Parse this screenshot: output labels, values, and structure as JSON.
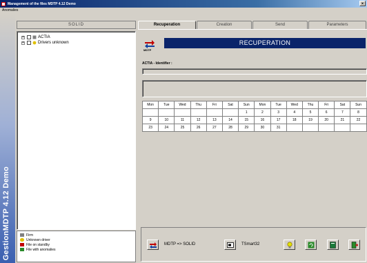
{
  "window": {
    "title": "Management of the files MDTP 4.12 Demo",
    "close_glyph": "×"
  },
  "menu": {
    "items": [
      "Anomalies"
    ]
  },
  "side_banner": {
    "text": "GestionMDTP 4.12 Demo"
  },
  "left_panel": {
    "header": "SOLID",
    "tree": [
      {
        "label": "ACTIA",
        "expand": "+"
      },
      {
        "label": "Drivers unknown",
        "expand": "+"
      }
    ],
    "legend": [
      {
        "label": "Firm",
        "color": "#808080"
      },
      {
        "label": "Unknown driver",
        "color": "#e0c000"
      },
      {
        "label": "File on standby",
        "color": "#c00000"
      },
      {
        "label": "File with anomalies",
        "color": "#2a8a2a"
      }
    ]
  },
  "tabs": [
    {
      "label": "Recuperation",
      "active": true
    },
    {
      "label": "Creation",
      "active": false
    },
    {
      "label": "Send",
      "active": false
    },
    {
      "label": "Parameters",
      "active": false
    }
  ],
  "recuperation": {
    "logo_label": "MDTP",
    "banner": "RECUPERATION",
    "identifier_label": "ACTIA - Identifier :",
    "calendar": {
      "headers": [
        "Mon",
        "Tue",
        "Wed",
        "Thu",
        "Fri",
        "Sat",
        "Sun",
        "Mon",
        "Tue",
        "Wed",
        "Thu",
        "Fri",
        "Sat",
        "Sun"
      ],
      "rows": [
        [
          "",
          "",
          "",
          "",
          "",
          "",
          "1",
          "2",
          "3",
          "4",
          "5",
          "6",
          "7",
          "8"
        ],
        [
          "9",
          "10",
          "11",
          "12",
          "13",
          "14",
          "15",
          "16",
          "17",
          "18",
          "19",
          "20",
          "21",
          "22"
        ],
        [
          "23",
          "24",
          "25",
          "26",
          "27",
          "28",
          "29",
          "30",
          "31",
          "",
          "",
          "",
          "",
          ""
        ]
      ]
    },
    "actions": {
      "mdtp_solid_label": "MDTP => SOLID",
      "tsmart_label": "TSmart32"
    }
  },
  "colors": {
    "accent": "#0a246a",
    "face": "#d4d0c8"
  }
}
